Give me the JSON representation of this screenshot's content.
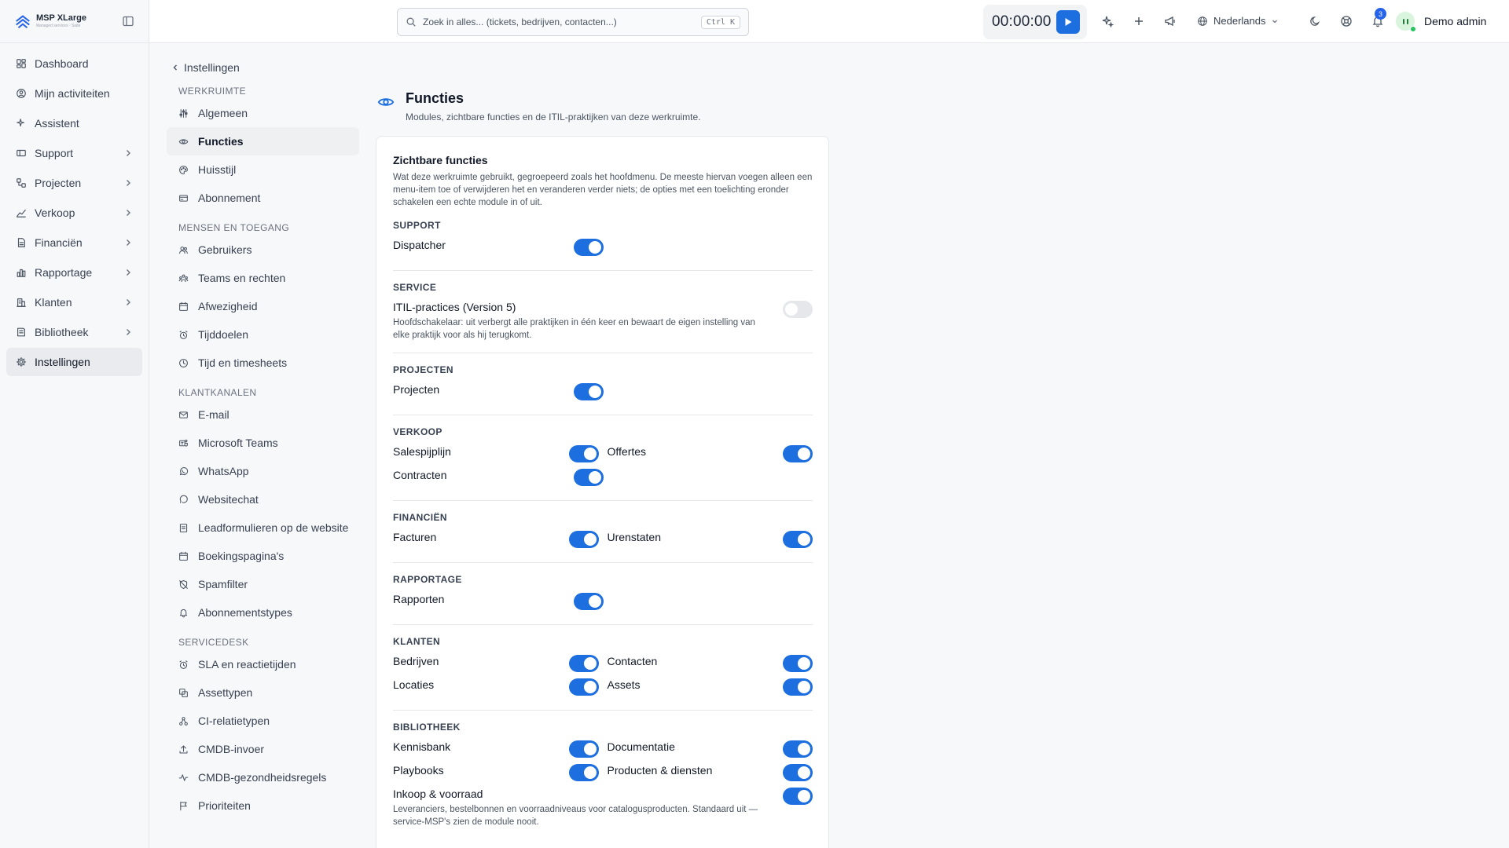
{
  "brand": {
    "name": "MSP XLarge",
    "tagline": "Managed services · Suite"
  },
  "sidebar": {
    "items": [
      {
        "label": "Dashboard",
        "icon": "dashboard-icon",
        "has_children": false
      },
      {
        "label": "Mijn activiteiten",
        "icon": "user-circle-icon",
        "has_children": false
      },
      {
        "label": "Assistent",
        "icon": "sparkle-icon",
        "has_children": false
      },
      {
        "label": "Support",
        "icon": "ticket-icon",
        "has_children": true
      },
      {
        "label": "Projecten",
        "icon": "projects-icon",
        "has_children": true
      },
      {
        "label": "Verkoop",
        "icon": "trend-icon",
        "has_children": true
      },
      {
        "label": "Financiën",
        "icon": "document-icon",
        "has_children": true
      },
      {
        "label": "Rapportage",
        "icon": "bar-chart-icon",
        "has_children": true
      },
      {
        "label": "Klanten",
        "icon": "building-icon",
        "has_children": true
      },
      {
        "label": "Bibliotheek",
        "icon": "book-icon",
        "has_children": true
      },
      {
        "label": "Instellingen",
        "icon": "gear-icon",
        "has_children": false,
        "active": true
      }
    ]
  },
  "topbar": {
    "search_placeholder": "Zoek in alles... (tickets, bedrijven, contacten...)",
    "search_shortcut": "Ctrl K",
    "timer": "00:00:00",
    "language": "Nederlands",
    "notification_count": "3",
    "user_name": "Demo admin"
  },
  "subnav": {
    "back_label": "Instellingen",
    "sections": [
      {
        "title": "WERKRUIMTE",
        "items": [
          {
            "label": "Algemeen",
            "icon": "sliders-icon"
          },
          {
            "label": "Functies",
            "icon": "eye-icon",
            "active": true
          },
          {
            "label": "Huisstijl",
            "icon": "palette-icon"
          },
          {
            "label": "Abonnement",
            "icon": "credit-card-icon"
          }
        ]
      },
      {
        "title": "MENSEN EN TOEGANG",
        "items": [
          {
            "label": "Gebruikers",
            "icon": "users-icon"
          },
          {
            "label": "Teams en rechten",
            "icon": "team-icon"
          },
          {
            "label": "Afwezigheid",
            "icon": "calendar-icon"
          },
          {
            "label": "Tijddoelen",
            "icon": "alarm-icon"
          },
          {
            "label": "Tijd en timesheets",
            "icon": "clock-icon"
          }
        ]
      },
      {
        "title": "KLANTKANALEN",
        "items": [
          {
            "label": "E-mail",
            "icon": "mail-icon"
          },
          {
            "label": "Microsoft Teams",
            "icon": "teams-icon"
          },
          {
            "label": "WhatsApp",
            "icon": "whatsapp-icon"
          },
          {
            "label": "Websitechat",
            "icon": "chat-icon"
          },
          {
            "label": "Leadformulieren op de website",
            "icon": "form-icon"
          },
          {
            "label": "Boekingspagina's",
            "icon": "calendar-icon"
          },
          {
            "label": "Spamfilter",
            "icon": "shield-off-icon"
          },
          {
            "label": "Abonnementstypes",
            "icon": "bell-icon"
          }
        ]
      },
      {
        "title": "SERVICEDESK",
        "items": [
          {
            "label": "SLA en reactietijden",
            "icon": "alarm-icon"
          },
          {
            "label": "Assettypen",
            "icon": "copy-icon"
          },
          {
            "label": "CI-relatietypen",
            "icon": "relation-icon"
          },
          {
            "label": "CMDB-invoer",
            "icon": "upload-icon"
          },
          {
            "label": "CMDB-gezondheidsregels",
            "icon": "pulse-icon"
          },
          {
            "label": "Prioriteiten",
            "icon": "flag-icon"
          }
        ]
      }
    ]
  },
  "page": {
    "title": "Functies",
    "description": "Modules, zichtbare functies en de ITIL-praktijken van deze werkruimte."
  },
  "card": {
    "title": "Zichtbare functies",
    "description": "Wat deze werkruimte gebruikt, gegroepeerd zoals het hoofdmenu. De meeste hiervan voegen alleen een menu-item toe of verwijderen het en veranderen verder niets; de opties met een toelichting eronder schakelen een echte module in of uit.",
    "groups": [
      {
        "title": "SUPPORT",
        "rows": [
          [
            {
              "label": "Dispatcher",
              "on": true
            }
          ]
        ]
      },
      {
        "title": "SERVICE",
        "rows": [
          [
            {
              "label": "ITIL-practices (Version 5)",
              "on": false,
              "wide": true,
              "note": "Hoofdschakelaar: uit verbergt alle praktijken in één keer en bewaart de eigen instelling van elke praktijk voor als hij terugkomt."
            }
          ]
        ]
      },
      {
        "title": "PROJECTEN",
        "rows": [
          [
            {
              "label": "Projecten",
              "on": true
            }
          ]
        ]
      },
      {
        "title": "VERKOOP",
        "rows": [
          [
            {
              "label": "Salespijplijn",
              "on": true
            },
            {
              "label": "Offertes",
              "on": true
            }
          ],
          [
            {
              "label": "Contracten",
              "on": true
            }
          ]
        ]
      },
      {
        "title": "FINANCIËN",
        "rows": [
          [
            {
              "label": "Facturen",
              "on": true
            },
            {
              "label": "Urenstaten",
              "on": true
            }
          ]
        ]
      },
      {
        "title": "RAPPORTAGE",
        "rows": [
          [
            {
              "label": "Rapporten",
              "on": true
            }
          ]
        ]
      },
      {
        "title": "KLANTEN",
        "rows": [
          [
            {
              "label": "Bedrijven",
              "on": true
            },
            {
              "label": "Contacten",
              "on": true
            }
          ],
          [
            {
              "label": "Locaties",
              "on": true
            },
            {
              "label": "Assets",
              "on": true
            }
          ]
        ]
      },
      {
        "title": "BIBLIOTHEEK",
        "rows": [
          [
            {
              "label": "Kennisbank",
              "on": true
            },
            {
              "label": "Documentatie",
              "on": true
            }
          ],
          [
            {
              "label": "Playbooks",
              "on": true
            },
            {
              "label": "Producten & diensten",
              "on": true
            }
          ],
          [
            {
              "label": "Inkoop & voorraad",
              "on": true,
              "wide": true,
              "note": "Leveranciers, bestelbonnen en voorraadniveaus voor catalogusproducten. Standaard uit — service-MSP's zien de module nooit."
            }
          ]
        ]
      }
    ]
  },
  "colors": {
    "accent": "#1d6fe0",
    "toggle_off": "#e5e7eb",
    "active_bg": "#eef0f2"
  }
}
